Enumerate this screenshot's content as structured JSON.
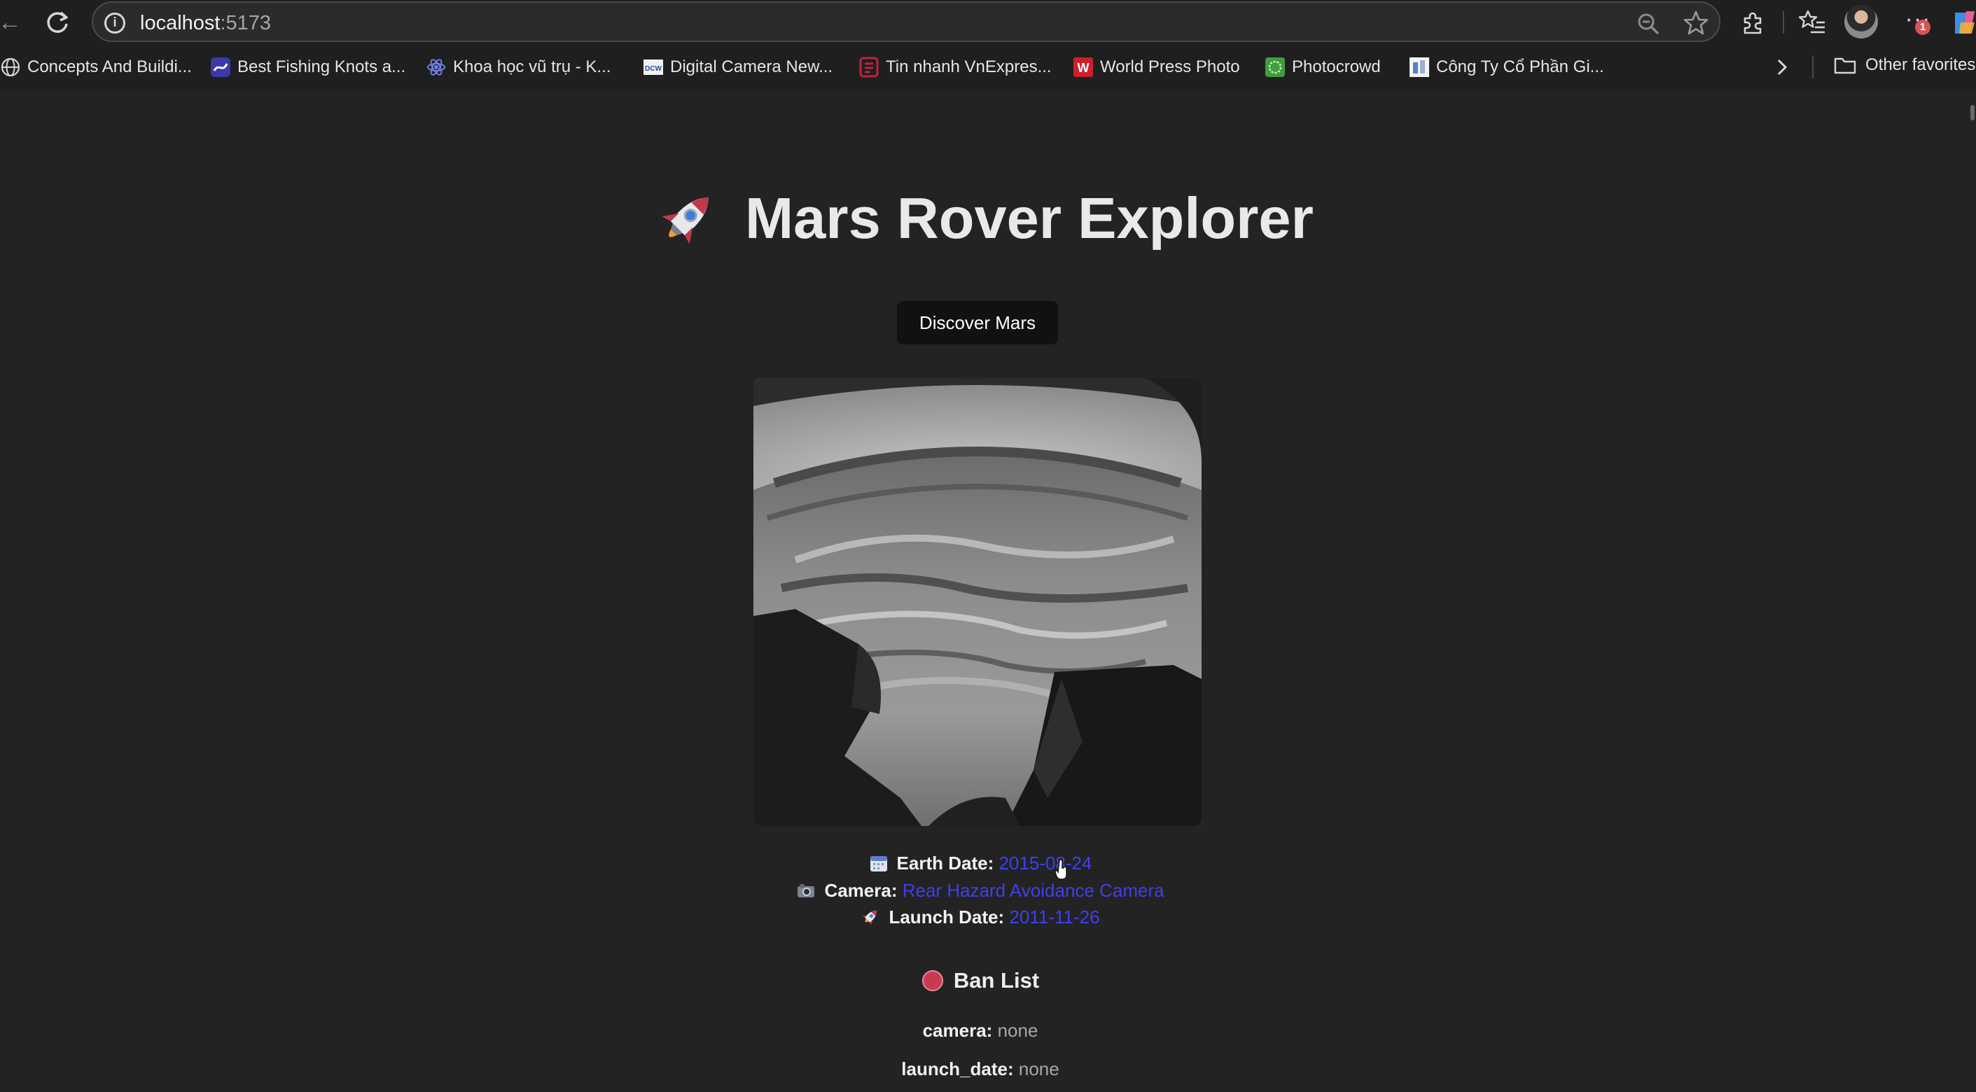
{
  "browser": {
    "url_host": "localhost",
    "url_port": ":5173",
    "bookmarks": [
      {
        "label": "Concepts And Buildi...",
        "icon": "globe-icon"
      },
      {
        "label": "Best Fishing Knots a...",
        "icon": "fishing-knot-favicon"
      },
      {
        "label": "Khoa học vũ trụ - K...",
        "icon": "atom-favicon"
      },
      {
        "label": "Digital Camera New...",
        "icon": "dcw-favicon"
      },
      {
        "label": "Tin nhanh VnExpres...",
        "icon": "vnexpress-favicon"
      },
      {
        "label": "World Press Photo",
        "icon": "world-press-photo-favicon"
      },
      {
        "label": "Photocrowd",
        "icon": "photocrowd-favicon"
      },
      {
        "label": "Công Ty Cổ Phần Gi...",
        "icon": "company-favicon"
      }
    ],
    "other_favorites": "Other favorites",
    "notification_count": "1",
    "colors": {
      "chrome": "#1f1f1f",
      "address_bar": "#2b2b2b"
    }
  },
  "app": {
    "title": "Mars Rover Explorer",
    "title_icon": "rocket-icon",
    "discover_button": "Discover Mars",
    "photo": {
      "description_icon": "mars-rover-photo"
    },
    "details": {
      "earth_date_label": "Earth Date:",
      "earth_date_value": "2015-08-24",
      "camera_label": "Camera:",
      "camera_value": "Rear Hazard Avoidance Camera",
      "launch_date_label": "Launch Date:",
      "launch_date_value": "2011-11-26"
    },
    "ban_list": {
      "title": "Ban List",
      "rows": [
        {
          "key": "camera:",
          "value": "none"
        },
        {
          "key": "launch_date:",
          "value": "none"
        }
      ]
    },
    "colors": {
      "background": "#232323",
      "link": "#3f3fee",
      "button": "#111111"
    }
  }
}
